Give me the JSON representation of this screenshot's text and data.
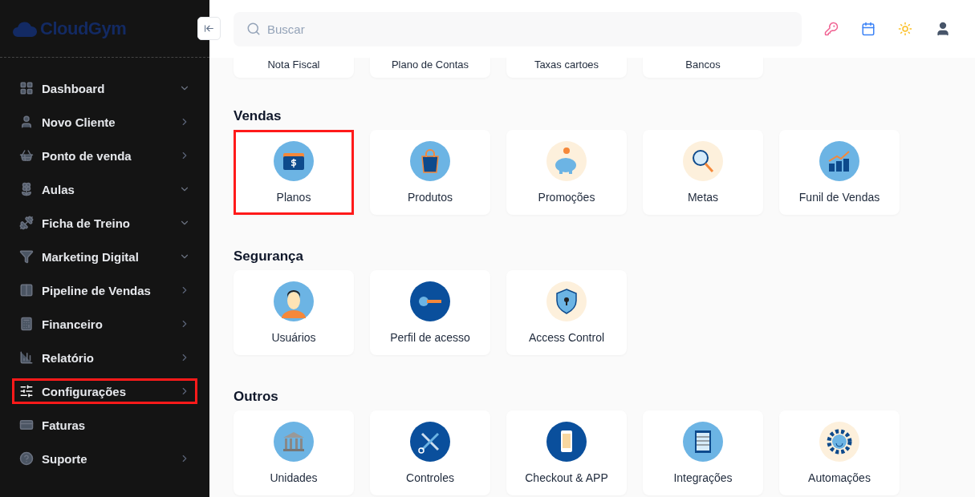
{
  "sidebar": {
    "logo": "CloudGym",
    "items": [
      {
        "label": "Dashboard",
        "has_submenu": true,
        "expanded": true,
        "highlighted": false
      },
      {
        "label": "Novo Cliente",
        "has_submenu": true,
        "expanded": false,
        "highlighted": false
      },
      {
        "label": "Ponto de venda",
        "has_submenu": true,
        "expanded": false,
        "highlighted": false
      },
      {
        "label": "Aulas",
        "has_submenu": true,
        "expanded": true,
        "highlighted": false
      },
      {
        "label": "Ficha de Treino",
        "has_submenu": true,
        "expanded": true,
        "highlighted": false
      },
      {
        "label": "Marketing Digital",
        "has_submenu": true,
        "expanded": true,
        "highlighted": false
      },
      {
        "label": "Pipeline de Vendas",
        "has_submenu": true,
        "expanded": false,
        "highlighted": false
      },
      {
        "label": "Financeiro",
        "has_submenu": true,
        "expanded": false,
        "highlighted": false
      },
      {
        "label": "Relatório",
        "has_submenu": true,
        "expanded": false,
        "highlighted": false
      },
      {
        "label": "Configurações",
        "has_submenu": true,
        "expanded": false,
        "highlighted": true
      },
      {
        "label": "Faturas",
        "has_submenu": false,
        "highlighted": false
      },
      {
        "label": "Suporte",
        "has_submenu": true,
        "expanded": false,
        "highlighted": false
      }
    ]
  },
  "search": {
    "placeholder": "Buscar"
  },
  "cut_row": [
    "Nota Fiscal",
    "Plano de Contas",
    "Taxas cartoes",
    "Bancos"
  ],
  "sections": [
    {
      "title": "Vendas",
      "cards": [
        {
          "label": "Planos",
          "highlighted": true
        },
        {
          "label": "Produtos",
          "highlighted": false
        },
        {
          "label": "Promoções",
          "highlighted": false
        },
        {
          "label": "Metas",
          "highlighted": false
        },
        {
          "label": "Funil de Vendas",
          "highlighted": false
        }
      ]
    },
    {
      "title": "Segurança",
      "cards": [
        {
          "label": "Usuários",
          "highlighted": false
        },
        {
          "label": "Perfil de acesso",
          "highlighted": false
        },
        {
          "label": "Access Control",
          "highlighted": false
        }
      ]
    },
    {
      "title": "Outros",
      "cards": [
        {
          "label": "Unidades",
          "highlighted": false
        },
        {
          "label": "Controles",
          "highlighted": false
        },
        {
          "label": "Checkout & APP",
          "highlighted": false
        },
        {
          "label": "Integrações",
          "highlighted": false
        },
        {
          "label": "Automações",
          "highlighted": false
        }
      ]
    }
  ]
}
